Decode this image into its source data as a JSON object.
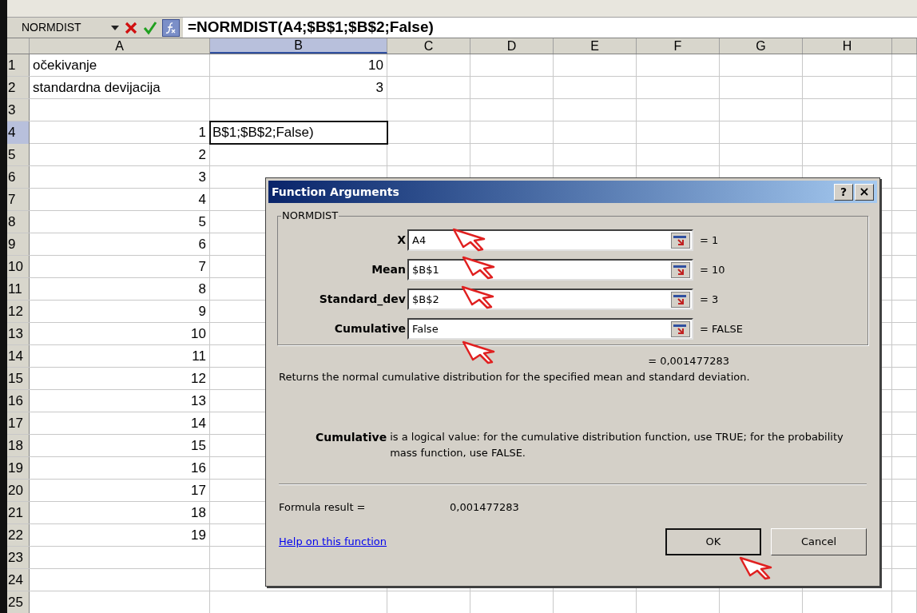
{
  "name_box": "NORMDIST",
  "formula": "=NORMDIST(A4;$B$1;$B$2;False)",
  "columns": [
    {
      "label": "A",
      "selected": false
    },
    {
      "label": "B",
      "selected": true
    },
    {
      "label": "C",
      "selected": false
    },
    {
      "label": "D",
      "selected": false
    },
    {
      "label": "E",
      "selected": false
    },
    {
      "label": "F",
      "selected": false
    },
    {
      "label": "G",
      "selected": false
    },
    {
      "label": "H",
      "selected": false
    }
  ],
  "rows": [
    {
      "label": "1",
      "selected": false,
      "cells": [
        {
          "kind": "text",
          "text": "očekivanje"
        },
        {
          "kind": "number",
          "text": "10"
        }
      ]
    },
    {
      "label": "2",
      "selected": false,
      "cells": [
        {
          "kind": "text",
          "text": "standardna devijacija"
        },
        {
          "kind": "number",
          "text": "3"
        }
      ]
    },
    {
      "label": "3",
      "selected": false,
      "cells": []
    },
    {
      "label": "4",
      "selected": true,
      "cells": [
        {
          "kind": "number",
          "text": "1"
        },
        {
          "kind": "editing",
          "text": "B$1;$B$2;False)"
        }
      ]
    },
    {
      "label": "5",
      "selected": false,
      "cells": [
        {
          "kind": "number",
          "text": "2"
        }
      ]
    },
    {
      "label": "6",
      "selected": false,
      "cells": [
        {
          "kind": "number",
          "text": "3"
        }
      ]
    },
    {
      "label": "7",
      "selected": false,
      "cells": [
        {
          "kind": "number",
          "text": "4"
        }
      ]
    },
    {
      "label": "8",
      "selected": false,
      "cells": [
        {
          "kind": "number",
          "text": "5"
        }
      ]
    },
    {
      "label": "9",
      "selected": false,
      "cells": [
        {
          "kind": "number",
          "text": "6"
        }
      ]
    },
    {
      "label": "10",
      "selected": false,
      "cells": [
        {
          "kind": "number",
          "text": "7"
        }
      ]
    },
    {
      "label": "11",
      "selected": false,
      "cells": [
        {
          "kind": "number",
          "text": "8"
        }
      ]
    },
    {
      "label": "12",
      "selected": false,
      "cells": [
        {
          "kind": "number",
          "text": "9"
        }
      ]
    },
    {
      "label": "13",
      "selected": false,
      "cells": [
        {
          "kind": "number",
          "text": "10"
        }
      ]
    },
    {
      "label": "14",
      "selected": false,
      "cells": [
        {
          "kind": "number",
          "text": "11"
        }
      ]
    },
    {
      "label": "15",
      "selected": false,
      "cells": [
        {
          "kind": "number",
          "text": "12"
        }
      ]
    },
    {
      "label": "16",
      "selected": false,
      "cells": [
        {
          "kind": "number",
          "text": "13"
        }
      ]
    },
    {
      "label": "17",
      "selected": false,
      "cells": [
        {
          "kind": "number",
          "text": "14"
        }
      ]
    },
    {
      "label": "18",
      "selected": false,
      "cells": [
        {
          "kind": "number",
          "text": "15"
        }
      ]
    },
    {
      "label": "19",
      "selected": false,
      "cells": [
        {
          "kind": "number",
          "text": "16"
        }
      ]
    },
    {
      "label": "20",
      "selected": false,
      "cells": [
        {
          "kind": "number",
          "text": "17"
        }
      ]
    },
    {
      "label": "21",
      "selected": false,
      "cells": [
        {
          "kind": "number",
          "text": "18"
        }
      ]
    },
    {
      "label": "22",
      "selected": false,
      "cells": [
        {
          "kind": "number",
          "text": "19"
        }
      ]
    },
    {
      "label": "23",
      "selected": false,
      "cells": []
    },
    {
      "label": "24",
      "selected": false,
      "cells": []
    },
    {
      "label": "25",
      "selected": false,
      "cells": []
    }
  ],
  "dialog": {
    "title": "Function Arguments",
    "help_button": "?",
    "close_button": "×",
    "group": "NORMDIST",
    "arguments": [
      {
        "name": "X",
        "value": "A4",
        "result": "= 1"
      },
      {
        "name": "Mean",
        "value": "$B$1",
        "result": "= 10"
      },
      {
        "name": "Standard_dev",
        "value": "$B$2",
        "result": "= 3"
      },
      {
        "name": "Cumulative",
        "value": "False",
        "result": "= FALSE"
      }
    ],
    "total_result": "= 0,001477283",
    "description": "Returns the normal cumulative distribution for the specified mean and standard deviation.",
    "argument_help": {
      "name": "Cumulative",
      "text": "is a logical value: for the cumulative distribution function, use TRUE; for the probability mass function, use FALSE."
    },
    "formula_result_label": "Formula result =",
    "formula_result_value": "0,001477283",
    "help_link": "Help on this function",
    "buttons": [
      {
        "label": "OK",
        "default": true
      },
      {
        "label": "Cancel",
        "default": false
      }
    ]
  }
}
